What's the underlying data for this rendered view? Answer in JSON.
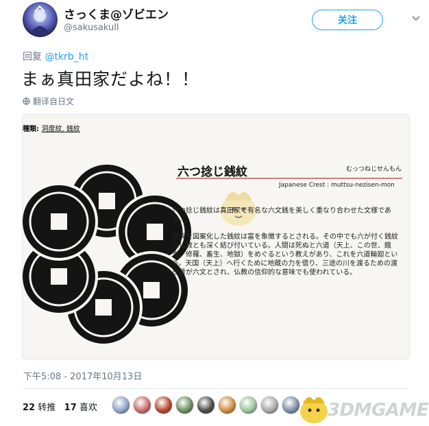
{
  "header": {
    "display_name": "さっくま@ゾビエン",
    "handle": "@sakusakull",
    "follow_label": "关注"
  },
  "reply": {
    "prefix": "回复",
    "mention": "@tkrb_ht"
  },
  "tweet": {
    "text": "まぁ真田家だよね！！",
    "translate_label": "翻译自日文"
  },
  "card": {
    "types_label": "種類:",
    "types_value": "洞度紋, 銭紋",
    "crest_title": "六つ捻じ銭紋",
    "crest_reading": "むっつねじせんもん",
    "crest_english": "Japanese Crest : muttsu-nezisen-mon",
    "paragraph1": "六つ捻じ銭紋は真田家で有名な六文銭を美しく重なり合わせた文様である。",
    "paragraph2": "銭貨を図案化した銭紋は富を象徴するとされる。その中でも六が付く銭紋は仏教とも深く結び付いている。人間は死ぬと六道（天上、この世、餓鬼、修羅、畜生、地獄）をめぐるという教えがあり、これを六道輪廻という。天国（天上）へ行くために地蔵の力を借り、三途の川を渡るための渡り賃が六文とされ、仏教の信仰的な意味でも使われている。"
  },
  "footer": {
    "timestamp": "下午5:08 - 2017年10月13日",
    "retweet_count": "22",
    "retweet_label": "转推",
    "like_count": "17",
    "like_label": "喜欢"
  },
  "likers": [
    {
      "name": "liker-1",
      "color": "#8fa3c9"
    },
    {
      "name": "liker-2",
      "color": "#c96b6b"
    },
    {
      "name": "liker-3",
      "color": "#b5452f"
    },
    {
      "name": "liker-4",
      "color": "#6b8f5e"
    },
    {
      "name": "liker-5",
      "color": "#4a4a4a"
    },
    {
      "name": "liker-6",
      "color": "#d08a3c"
    },
    {
      "name": "liker-7",
      "color": "#9bc49b"
    },
    {
      "name": "liker-8",
      "color": "#a8a8a8"
    },
    {
      "name": "liker-9",
      "color": "#7d8ea8"
    }
  ],
  "watermark": {
    "text": "3DMGAME"
  },
  "colors": {
    "accent": "#1da1f2",
    "muted": "#657786",
    "title_underline": "#c9807b"
  }
}
